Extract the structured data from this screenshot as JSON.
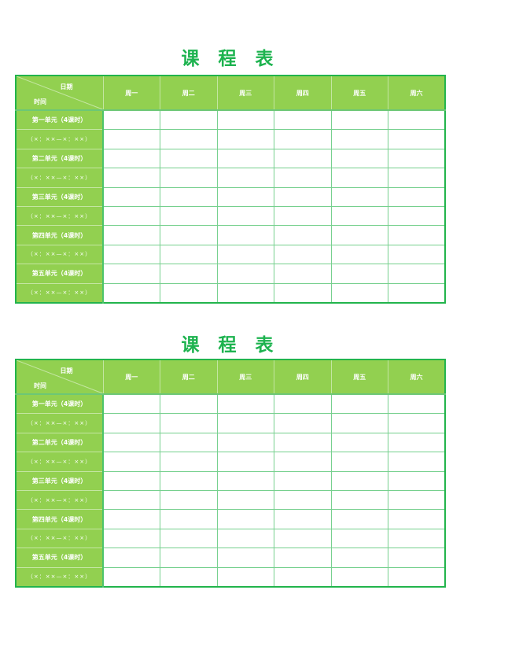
{
  "schedules": [
    {
      "title": "课 程 表",
      "corner": {
        "date_label": "日期",
        "time_label": "时间"
      },
      "days": [
        "周一",
        "周二",
        "周三",
        "周四",
        "周五",
        "周六"
      ],
      "rows": [
        "第一单元（4课时）",
        "（×：××—×：××）",
        "第二单元（4课时）",
        "（×：××—×：××）",
        "第三单元（4课时）",
        "（×：××—×：××）",
        "第四单元（4课时）",
        "（×：××—×：××）",
        "第五单元（4课时）",
        "（×：××—×：××）"
      ]
    },
    {
      "title": "课 程 表",
      "corner": {
        "date_label": "日期",
        "time_label": "时间"
      },
      "days": [
        "周一",
        "周二",
        "周三",
        "周四",
        "周五",
        "周六"
      ],
      "rows": [
        "第一单元（4课时）",
        "（×：××—×：××）",
        "第二单元（4课时）",
        "（×：××—×：××）",
        "第三单元（4课时）",
        "（×：××—×：××）",
        "第四单元（4课时）",
        "（×：××—×：××）",
        "第五单元（4课时）",
        "（×：××—×：××）"
      ]
    }
  ],
  "colors": {
    "title": "#1db34f",
    "header_fill": "#92d050",
    "border": "#22b44c",
    "grid": "#76d08e"
  }
}
